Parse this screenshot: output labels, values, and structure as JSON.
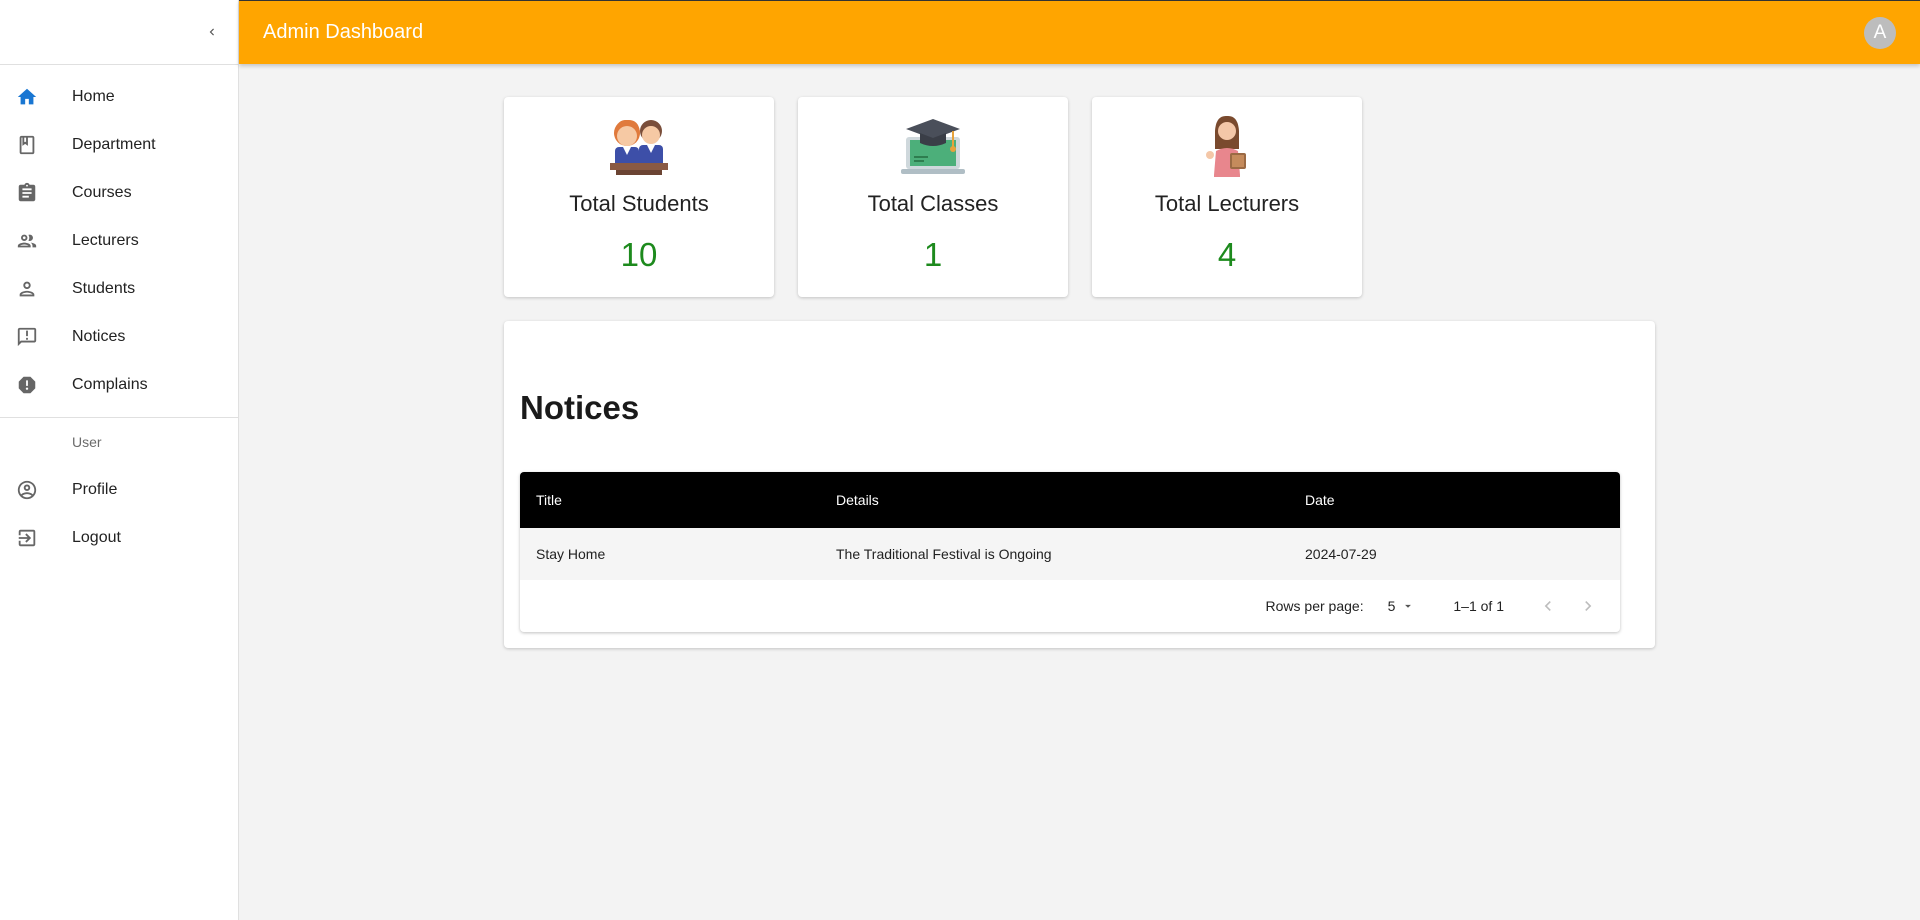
{
  "appbar": {
    "title": "Admin Dashboard",
    "avatar_initial": "A"
  },
  "sidebar": {
    "items": [
      {
        "label": "Home",
        "icon": "home-icon",
        "active": true
      },
      {
        "label": "Department",
        "icon": "book-icon"
      },
      {
        "label": "Courses",
        "icon": "clipboard-icon"
      },
      {
        "label": "Lecturers",
        "icon": "people-icon"
      },
      {
        "label": "Students",
        "icon": "person-icon"
      },
      {
        "label": "Notices",
        "icon": "feedback-icon"
      },
      {
        "label": "Complains",
        "icon": "report-icon"
      }
    ],
    "user_header": "User",
    "user_items": [
      {
        "label": "Profile",
        "icon": "account-circle-icon"
      },
      {
        "label": "Logout",
        "icon": "logout-icon"
      }
    ]
  },
  "stats": [
    {
      "title": "Total Students",
      "value": "10",
      "icon": "students-illustration"
    },
    {
      "title": "Total Classes",
      "value": "1",
      "icon": "graduation-laptop-illustration"
    },
    {
      "title": "Total Lecturers",
      "value": "4",
      "icon": "lecturer-illustration"
    }
  ],
  "notices": {
    "heading": "Notices",
    "columns": [
      "Title",
      "Details",
      "Date"
    ],
    "rows": [
      {
        "title": "Stay Home",
        "details": "The Traditional Festival is Ongoing",
        "date": "2024-07-29"
      }
    ],
    "pagination": {
      "rows_per_page_label": "Rows per page:",
      "rows_per_page": "5",
      "range": "1–1 of 1"
    }
  },
  "colors": {
    "appbar": "#ffa500",
    "active_icon": "#1976d2",
    "stat_value": "#1d8a1d",
    "table_header": "#000000"
  }
}
